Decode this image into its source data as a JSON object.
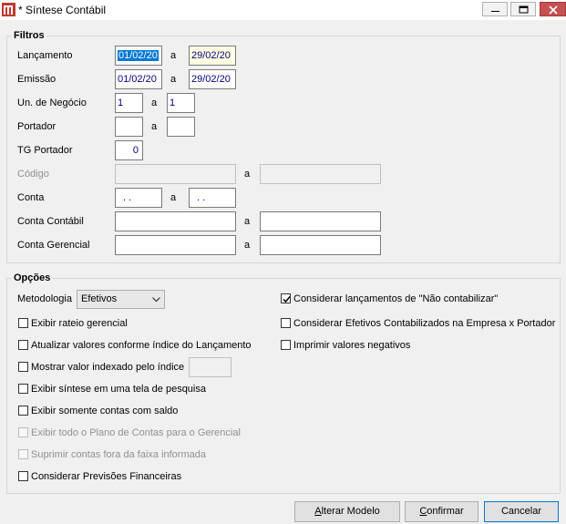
{
  "window": {
    "title": "* Síntese Contábil"
  },
  "filtros": {
    "legend": "Filtros",
    "rows": {
      "lancamento": {
        "label": "Lançamento",
        "from": "01/02/20",
        "sep": "a",
        "to": "29/02/20"
      },
      "emissao": {
        "label": "Emissão",
        "from": "01/02/20",
        "sep": "a",
        "to": "29/02/20"
      },
      "un_negocio": {
        "label": "Un. de Negócio",
        "from": "1",
        "sep": "a",
        "to": "1"
      },
      "portador": {
        "label": "Portador",
        "from": "",
        "sep": "a",
        "to": ""
      },
      "tg_portador": {
        "label": "TG Portador",
        "value": "0"
      },
      "codigo": {
        "label": "Código",
        "from": "",
        "sep": "a",
        "to": ""
      },
      "conta": {
        "label": "Conta",
        "from": ". .",
        "sep": "a",
        "to": ". ."
      },
      "conta_contabil": {
        "label": "Conta Contábil",
        "from": "",
        "sep": "a",
        "to": ""
      },
      "conta_gerencial": {
        "label": "Conta Gerencial",
        "from": "",
        "sep": "a",
        "to": ""
      }
    }
  },
  "opcoes": {
    "legend": "Opções",
    "metodologia": {
      "label": "Metodologia",
      "selected": "Efetivos"
    },
    "left_checks": [
      {
        "label": "Exibir rateio gerencial",
        "checked": false,
        "enabled": true
      },
      {
        "label": "Atualizar valores conforme índice do Lançamento",
        "checked": false,
        "enabled": true
      },
      {
        "label": "Mostrar valor indexado pelo índice",
        "checked": false,
        "enabled": true
      },
      {
        "label": "Exibir síntese em uma tela de pesquisa",
        "checked": false,
        "enabled": true
      },
      {
        "label": "Exibir somente contas com saldo",
        "checked": false,
        "enabled": true
      },
      {
        "label": "Exibir todo o Plano de Contas para o Gerencial",
        "checked": false,
        "enabled": false
      },
      {
        "label": "Suprimir contas fora da faixa informada",
        "checked": false,
        "enabled": false
      },
      {
        "label": "Considerar Previsões Financeiras",
        "checked": false,
        "enabled": true
      }
    ],
    "right_checks": [
      {
        "label": "Considerar lançamentos de \"Não contabilizar\"",
        "checked": true,
        "enabled": true
      },
      {
        "label": "Considerar Efetivos Contabilizados na Empresa x Portador",
        "checked": false,
        "enabled": true
      },
      {
        "label": "Imprimir valores negativos",
        "checked": false,
        "enabled": true
      }
    ],
    "indice_value": ""
  },
  "buttons": {
    "alterar_modelo": {
      "mnemonic": "A",
      "rest": "lterar Modelo"
    },
    "confirmar": {
      "mnemonic": "C",
      "rest": "onfirmar"
    },
    "cancelar": {
      "mnemonic": "",
      "rest": "Cancelar"
    }
  },
  "colors": {
    "selection": "#0078d7",
    "input_text": "#000080",
    "close_button": "#c75050",
    "focus_field": "#ffffe1"
  }
}
